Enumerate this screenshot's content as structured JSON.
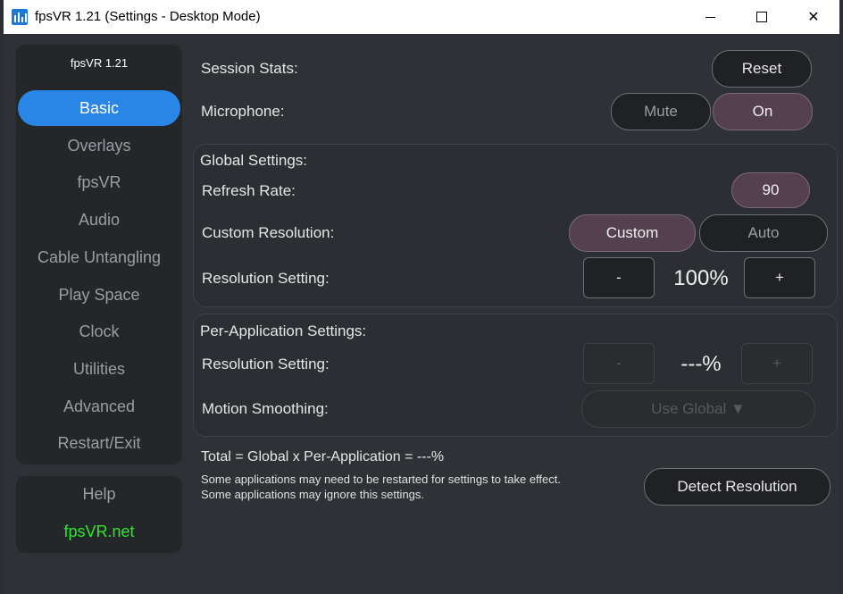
{
  "window": {
    "title": "fpsVR 1.21 (Settings - Desktop Mode)",
    "icons": {
      "app": "bar-chart-icon",
      "minimize": "minimize-icon",
      "maximize": "maximize-icon",
      "close": "close-icon"
    },
    "close_glyph": "✕"
  },
  "sidebar": {
    "version": "fpsVR 1.21",
    "items": [
      {
        "label": "Basic",
        "active": true
      },
      {
        "label": "Overlays",
        "active": false
      },
      {
        "label": "fpsVR",
        "active": false
      },
      {
        "label": "Audio",
        "active": false
      },
      {
        "label": "Cable Untangling",
        "active": false
      },
      {
        "label": "Play Space",
        "active": false
      },
      {
        "label": "Clock",
        "active": false
      },
      {
        "label": "Utilities",
        "active": false
      },
      {
        "label": "Advanced",
        "active": false
      },
      {
        "label": "Restart/Exit",
        "active": false
      }
    ],
    "help": "Help",
    "site": "fpsVR.net"
  },
  "basic": {
    "session_stats_label": "Session Stats:",
    "reset_label": "Reset",
    "microphone_label": "Microphone:",
    "mute_label": "Mute",
    "on_label": "On"
  },
  "global": {
    "title": "Global Settings:",
    "refresh_rate_label": "Refresh Rate:",
    "refresh_rate_value": "90",
    "custom_resolution_label": "Custom Resolution:",
    "custom_label": "Custom",
    "auto_label": "Auto",
    "resolution_setting_label": "Resolution Setting:",
    "minus": "-",
    "plus": "+",
    "resolution_value": "100%"
  },
  "per_app": {
    "title": "Per-Application Settings:",
    "resolution_setting_label": "Resolution Setting:",
    "minus": "-",
    "plus": "+",
    "resolution_value": "---%",
    "motion_smoothing_label": "Motion Smoothing:",
    "motion_smoothing_value": "Use Global ▼"
  },
  "footer": {
    "total": "Total = Global x Per-Application = ---%",
    "note1": "Some applications may need to be restarted for settings to take effect.",
    "note2": "Some applications may ignore this settings.",
    "detect_label": "Detect Resolution"
  },
  "colors": {
    "accent": "#2a86e6",
    "selected": "#54404f",
    "link": "#2ee62e",
    "background": "#2e3135"
  }
}
